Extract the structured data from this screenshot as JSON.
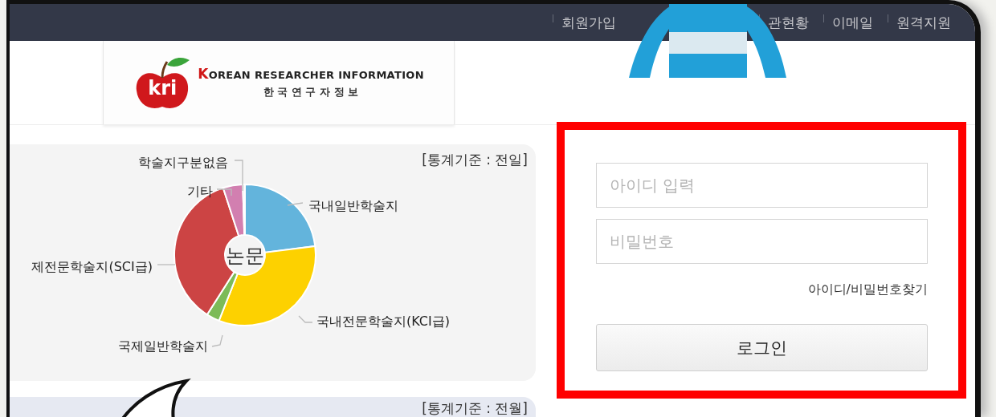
{
  "top_nav": {
    "items": [
      "회원가입",
      "관현황",
      "이메일",
      "원격지원"
    ]
  },
  "logo": {
    "mark": "kri",
    "name": "KOREAN RESEARCHER INFORMATION",
    "subtitle": "한 국 연 구 자 정 보"
  },
  "stats_panel": {
    "basis": "[통계기준 : 전일]",
    "chart_data": {
      "type": "donut",
      "title": "논문",
      "categories": [
        "국내일반학술지",
        "국내전문학술지(KCI급)",
        "국제일반학술지",
        "제전문학술지(SCI급)",
        "기타",
        "학술지구분없음"
      ],
      "values": [
        23,
        33,
        3,
        36,
        4.5,
        0.5
      ],
      "colors": [
        "#63b4dc",
        "#fdd100",
        "#7cbb58",
        "#cc4444",
        "#d27fb0",
        "#e8e8e8"
      ]
    }
  },
  "login": {
    "id_field": {
      "placeholder": "아이디 입력"
    },
    "password_field": {
      "placeholder": "비밀번호"
    },
    "find_link": "아이디/비밀번호찾기",
    "login_button": "로그인"
  },
  "second_panel": {
    "basis": "[통계기준 : 전월]"
  }
}
